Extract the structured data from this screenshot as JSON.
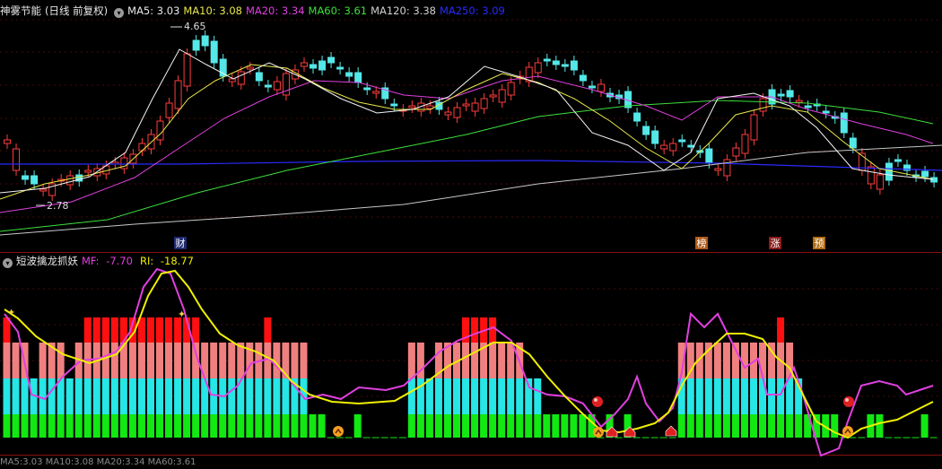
{
  "main_panel": {
    "stock_name": "神雾节能",
    "period": "(日线 前复权)",
    "dropdown_icon": "chevron-down-icon",
    "ma": [
      {
        "label": "MA5:",
        "value": "3.03",
        "color": "#e8e8e8"
      },
      {
        "label": "MA10:",
        "value": "3.08",
        "color": "#e8e84a"
      },
      {
        "label": "MA20:",
        "value": "3.34",
        "color": "#e040e0"
      },
      {
        "label": "MA60:",
        "value": "3.61",
        "color": "#3ce03c"
      },
      {
        "label": "MA120:",
        "value": "3.38",
        "color": "#d0d0d0"
      },
      {
        "label": "MA250:",
        "value": "3.09",
        "color": "#2a2aff"
      }
    ],
    "high_label": "4.65",
    "low_label": "2.78",
    "event_markers": [
      {
        "text": "财",
        "bg": "#1e2a6e",
        "color": "#ffffff"
      },
      {
        "text": "榜",
        "bg": "#b05a1a",
        "color": "#ffffff"
      },
      {
        "text": "涨",
        "bg": "#8a1a1a",
        "color": "#ffffff"
      },
      {
        "text": "预",
        "bg": "#b06a10",
        "color": "#ffffff"
      }
    ]
  },
  "sub_panel": {
    "indicator_name": "短波擒龙抓妖",
    "mf_label": "MF:",
    "mf_value": "-7.70",
    "ri_label": "RI:",
    "ri_value": "-18.77"
  },
  "bottom_status": "MA5:3.03 MA10:3.08 MA20:3.34 MA60:3.61"
}
